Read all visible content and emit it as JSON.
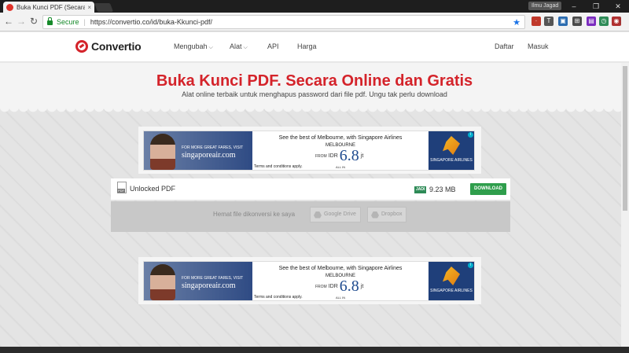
{
  "browser": {
    "tab_title": "Buka Kunci PDF (Secara",
    "tab_close": "×",
    "profile": "Ilmu Jagad",
    "window_controls": [
      "–",
      "❐",
      "✕"
    ],
    "secure_label": "Secure",
    "url": "https://convertio.co/id/buka-Kkunci-pdf/",
    "nav_icons": [
      "back-icon",
      "forward-icon",
      "reload-icon"
    ],
    "extensions": [
      {
        "label": "·",
        "color": "#c0392b"
      },
      {
        "label": "T",
        "color": "#555555"
      },
      {
        "label": "▣",
        "color": "#2b6cb0"
      },
      {
        "label": "⊞",
        "color": "#4a4a4a"
      },
      {
        "label": "▤",
        "color": "#7b2cbf"
      },
      {
        "label": "◷",
        "color": "#2e8b57"
      },
      {
        "label": "◉",
        "color": "#b03030"
      },
      {
        "label": "⛨",
        "color": "#8b1a1a"
      }
    ]
  },
  "site": {
    "logo_text": "Convertio",
    "nav": {
      "mengubah": "Mengubah",
      "alat": "Alat",
      "api": "API",
      "harga": "Harga",
      "daftar": "Daftar",
      "masuk": "Masuk"
    },
    "accent_color": "#d4232a"
  },
  "hero": {
    "title": "Buka Kunci PDF. Secara Online dan Gratis",
    "subtitle": "Alat online terbaik untuk menghapus password dari file pdf. Ungu tak perlu download"
  },
  "ad": {
    "small_text": "FOR MORE GREAT FARES, VISIT",
    "brand": "singaporeair.com",
    "headline": "See the best of Melbourne, with Singapore Airlines",
    "city": "MELBOURNE",
    "from": "FROM",
    "currency": "IDR",
    "price": "6.8",
    "unit": "jt",
    "all_in": "ALL IN",
    "terms": "Terms and conditions apply.",
    "airline": "SINGAPORE AIRLINES",
    "info": "i"
  },
  "file": {
    "name": "Unlocked PDF",
    "badge": "JADI",
    "size": "9.23 MB",
    "download_label": "DOWNLOAD"
  },
  "save": {
    "label": "Hemat file dikonversi ke saya",
    "google_drive": "Google Drive",
    "dropbox": "Dropbox"
  }
}
